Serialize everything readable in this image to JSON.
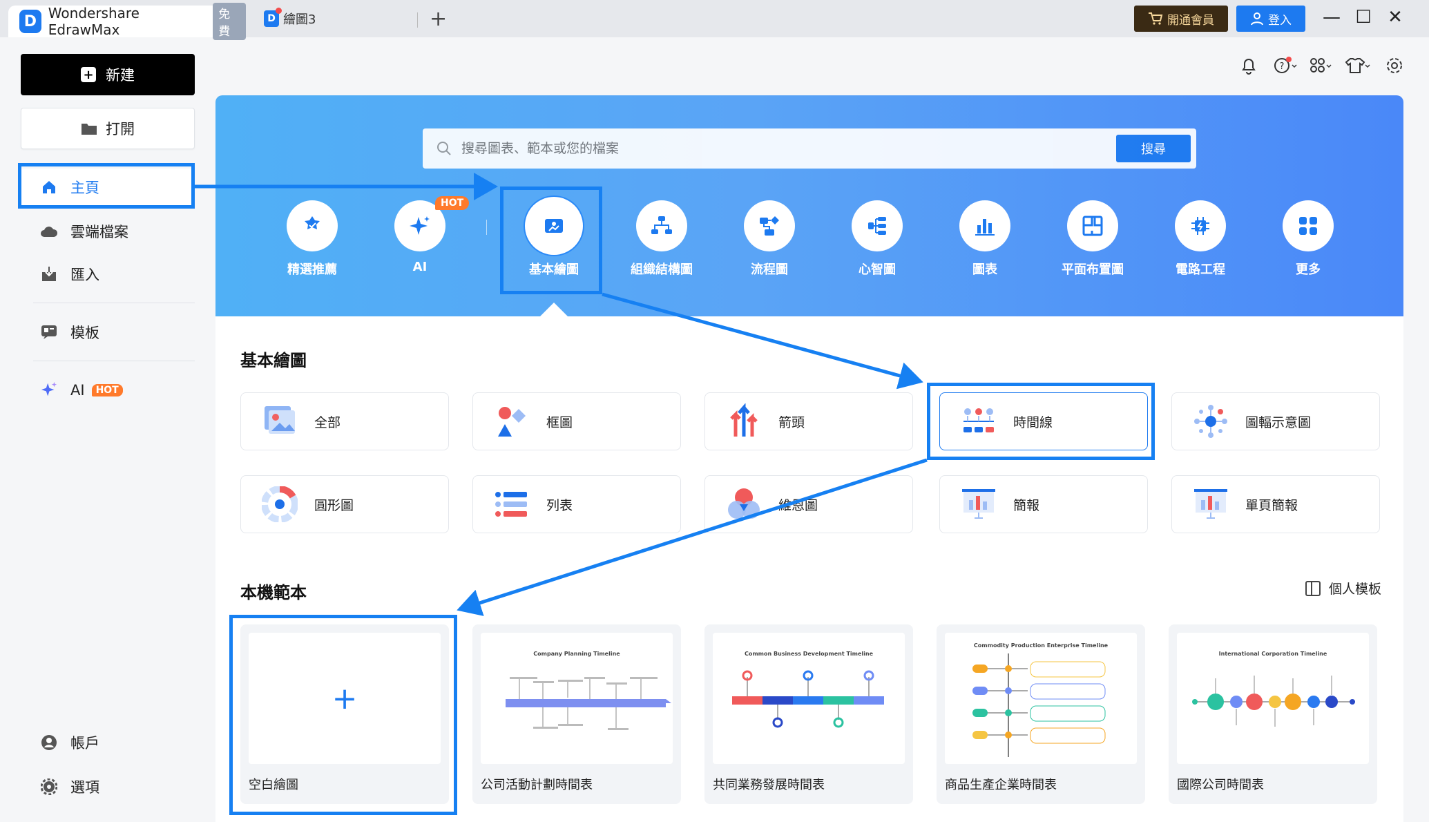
{
  "titlebar": {
    "app_name": "Wondershare EdrawMax",
    "free_badge": "免費",
    "doc_tab": "繪圖3",
    "new_tab": "+",
    "vip_button": "開通會員",
    "login_button": "登入"
  },
  "sidebar": {
    "new_button": "新建",
    "open_button": "打開",
    "items": [
      {
        "label": "主頁",
        "icon": "home-icon"
      },
      {
        "label": "雲端檔案",
        "icon": "cloud-icon"
      },
      {
        "label": "匯入",
        "icon": "import-icon"
      },
      {
        "label": "模板",
        "icon": "template-icon"
      },
      {
        "label": "AI",
        "icon": "ai-sparkle-icon",
        "badge": "HOT"
      },
      {
        "label": "帳戶",
        "icon": "account-icon"
      },
      {
        "label": "選項",
        "icon": "settings-icon"
      }
    ]
  },
  "search": {
    "placeholder": "搜尋圖表、範本或您的檔案",
    "button": "搜尋"
  },
  "categories": [
    {
      "label": "精選推薦"
    },
    {
      "label": "AI",
      "badge": "HOT"
    },
    {
      "label": "基本繪圖",
      "active": true
    },
    {
      "label": "組織結構圖"
    },
    {
      "label": "流程圖"
    },
    {
      "label": "心智圖"
    },
    {
      "label": "圖表"
    },
    {
      "label": "平面布置圖"
    },
    {
      "label": "電路工程"
    },
    {
      "label": "更多"
    }
  ],
  "basic": {
    "title": "基本繪圖",
    "tiles": [
      "全部",
      "框圖",
      "箭頭",
      "時間線",
      "圖輻示意圖",
      "圓形圖",
      "列表",
      "維恩圖",
      "簡報",
      "單頁簡報"
    ]
  },
  "local": {
    "title": "本機範本",
    "personal_templates": "個人模板",
    "blank_plus": "+",
    "cards": [
      {
        "label": "空白繪圖"
      },
      {
        "label": "公司活動計劃時間表",
        "thumb_title": "Company Planning Timeline"
      },
      {
        "label": "共同業務發展時間表",
        "thumb_title": "Common Business Development Timeline"
      },
      {
        "label": "商品生產企業時間表",
        "thumb_title": "Commodity Production Enterprise Timeline"
      },
      {
        "label": "國際公司時間表",
        "thumb_title": "International Corporation Timeline"
      }
    ]
  },
  "colors": {
    "accent": "#1d7af0",
    "highlight": "#1680f2",
    "hot": "#ff7a2b",
    "vip_bg": "#3a2a14"
  }
}
